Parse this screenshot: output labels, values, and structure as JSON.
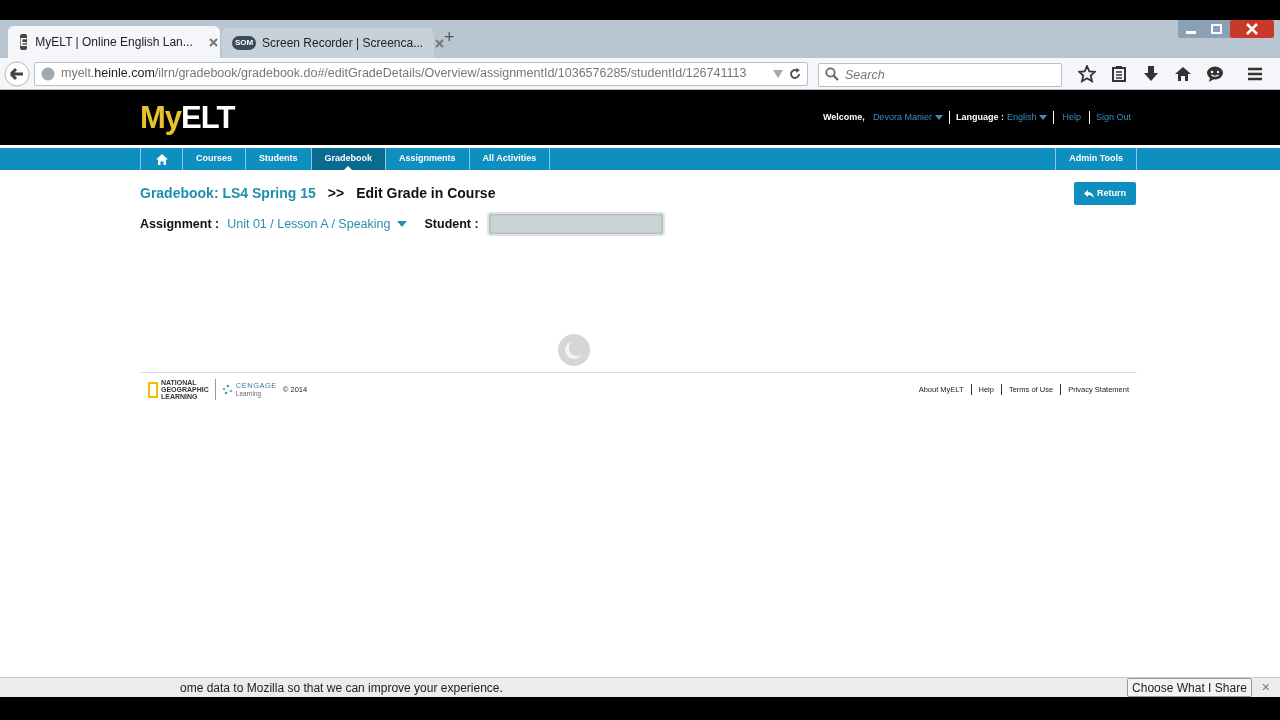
{
  "browser": {
    "tabs": [
      {
        "icon": "E",
        "label": "MyELT | Online English Lan...",
        "selected": true
      },
      {
        "icon": "SOM",
        "label": "Screen Recorder | Screenca...",
        "selected": false
      }
    ],
    "new_tab": "+",
    "url_host_prefix": "myelt.",
    "url_host": "heinle.com",
    "url_path": "/ilrn/gradebook/gradebook.do#/editGradeDetails/Overview/assignmentId/1036576285/studentId/126741113",
    "search": {
      "placeholder": "Search"
    }
  },
  "header": {
    "logo_my": "My",
    "logo_elt": "ELT",
    "welcome_label": "Welcome,",
    "user": "Devora Manier",
    "language_label": "Language :",
    "language": "English",
    "links": [
      "Help",
      "Sign Out"
    ]
  },
  "nav": {
    "items": [
      {
        "kind": "home",
        "selected": false
      },
      {
        "kind": "text",
        "label": "Courses",
        "selected": false
      },
      {
        "kind": "text",
        "label": "Students",
        "selected": false
      },
      {
        "kind": "text",
        "label": "Gradebook",
        "selected": true
      },
      {
        "kind": "text",
        "label": "Assignments",
        "selected": false
      },
      {
        "kind": "text",
        "label": "All Activities",
        "selected": false
      }
    ],
    "right_item": "Admin Tools"
  },
  "page": {
    "breadcrumb_link": "Gradebook: LS4 Spring 15",
    "separator": ">>",
    "title": "Edit Grade in Course",
    "return_button": "Return",
    "assignment_label": "Assignment :",
    "assignment": "Unit 01 / Lesson A / Speaking",
    "student_label": "Student :"
  },
  "footer": {
    "ng_lines": [
      "NATIONAL",
      "GEOGRAPHIC",
      "LEARNING"
    ],
    "cengage": "CENGAGE",
    "cengage_sub": "Learning",
    "copyright": "© 2014",
    "links": [
      "About MyELT",
      "Help",
      "Terms of Use",
      "Privacy Statement"
    ]
  },
  "notification": {
    "text": "ome data to Mozilla so that we can improve your experience.",
    "button": "Choose What I Share",
    "close": "×"
  }
}
